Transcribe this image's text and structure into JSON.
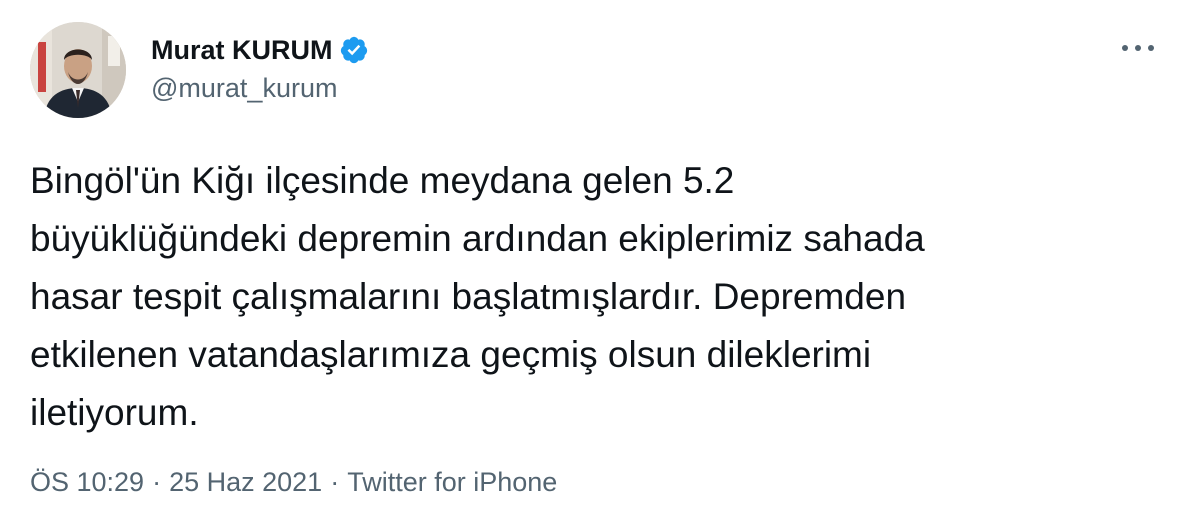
{
  "author": {
    "display_name": "Murat KURUM",
    "handle": "@murat_kurum",
    "verified_icon": "verified-badge-icon",
    "avatar_icon": "avatar"
  },
  "tweet": {
    "text": "Bingöl'ün Kiğı ilçesinde meydana gelen 5.2\nbüyüklüğündeki depremin ardından ekiplerimiz sahada\nhasar tespit çalışmalarını başlatmışlardır. Depremden\netkilenen vatandaşlarımıza geçmiş olsun dileklerimi\niletiyorum."
  },
  "meta": {
    "time": "ÖS 10:29",
    "separator": "·",
    "date": "25 Haz 2021",
    "source": "Twitter for iPhone"
  },
  "menu": {
    "more_icon": "more-options-icon"
  },
  "colors": {
    "text_primary": "#0f1419",
    "text_secondary": "#536471",
    "verified_blue": "#1d9bf0",
    "background": "#ffffff"
  }
}
